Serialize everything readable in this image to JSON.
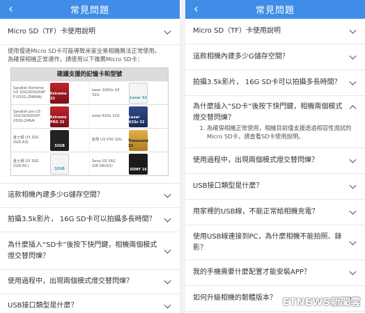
{
  "header": {
    "back_icon": "‹",
    "title": "常見問題"
  },
  "left": {
    "first_question": "Micro SD（TF）卡使用說明",
    "answer_line1": "使用慢速Micro SD卡可能導致米家全景相機無法正常使用。",
    "answer_line2": "為確保相機正常運作，請使用以下推薦Micro SD卡：",
    "card_table": {
      "title": "建議支援的記憶卡和型號",
      "rows": [
        {
          "cells": [
            {
              "label": "Sandisk Extreme\nU3 32G(SDSQXAF\nF-032G-ZN6MA)",
              "card": "red",
              "mark": "Extreme 32"
            },
            {
              "label": "lexar 1000x U3\n32G",
              "card": "white",
              "mark": "Lexar 32"
            }
          ]
        },
        {
          "cells": [
            {
              "label": "Sandisk pro U3\n32G(SDSDQXP-\n032G-Z46A)",
              "card": "red",
              "mark": "Extreme PRO 32"
            },
            {
              "label": "lexar 633x 32G",
              "card": "blue",
              "mark": "Lexar 633x 32"
            }
          ]
        },
        {
          "cells": [
            {
              "label": "金士頓 U3 32G\n(SDCA3)",
              "card": "black",
              "mark": "32GB"
            },
            {
              "label": "創見 U3 V30 32G",
              "card": "gold",
              "mark": "Transcend 32"
            }
          ]
        },
        {
          "cells": [
            {
              "label": "金士頓 U3 32G\n(SDCAC)",
              "card": "white",
              "mark": "32GB"
            },
            {
              "label": "Sony U3 16G\n(SR-16UX2)",
              "card": "dark",
              "mark": "SONY 16"
            }
          ]
        }
      ]
    },
    "questions": [
      "這款相機內建多少G儲存空間？",
      "拍攝3.5k影片， 16G SD卡可以拍攝多長時間？",
      "為什麼插入“SD卡”後按下快門鍵，相機兩個模式燈交替閃爍？",
      "使用過程中，出現兩個模式燈交替閃爍？",
      "USB接口類型是什麼？"
    ]
  },
  "right": {
    "questions": [
      "Micro SD（TF）卡使用說明",
      "這款相機內建多少G儲存空間？",
      "拍攝3.5k影片， 16G SD卡可以拍攝多長時間？",
      "為什麼插入“SD卡”後按下快門鍵，相機兩個模式燈交替閃爍？"
    ],
    "expanded_answer": "為確保相機正常使用，相機目前僅支援透過相容性測試的Micro SD卡，請查看SD卡使用說明。",
    "questions_after": [
      "使用過程中，出現兩個模式燈交替閃爍？",
      "USB接口類型是什麼？",
      "用家裡的USB線，不能正常給相機充電？",
      "使用USB線連接到PC，為什麼相機不能拍照、錄影？",
      "我的手機需要什麼配置才能安裝APP？",
      "如何升級相機的韌體版本？"
    ]
  },
  "watermark": "ETNEWS新聞雲",
  "colors": {
    "header_bg": "#3f8de6",
    "divider": "#e5e5e5"
  },
  "icons": {
    "collapsed": "chevron-down-icon",
    "expanded": "chevron-up-icon"
  }
}
